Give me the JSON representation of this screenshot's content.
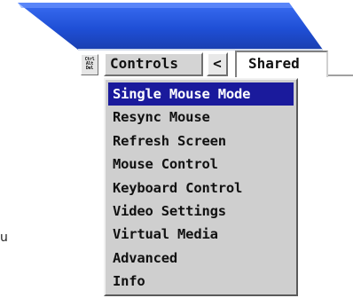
{
  "toolbar": {
    "cad_label": "Ctrl\nAlt\nDel",
    "controls_label": "Controls",
    "back_label": "<",
    "shared_label": "Shared"
  },
  "menu": {
    "items": [
      {
        "label": "Single Mouse Mode",
        "selected": true
      },
      {
        "label": "Resync Mouse",
        "selected": false
      },
      {
        "label": "Refresh Screen",
        "selected": false
      },
      {
        "label": "Mouse Control",
        "selected": false
      },
      {
        "label": "Keyboard Control",
        "selected": false
      },
      {
        "label": "Video Settings",
        "selected": false
      },
      {
        "label": "Virtual Media",
        "selected": false
      },
      {
        "label": "Advanced",
        "selected": false
      },
      {
        "label": "Info",
        "selected": false
      }
    ]
  },
  "background": {
    "partial_text": "u"
  },
  "colors": {
    "banner_blue": "#1f4fd6",
    "selection": "#1a1a9c",
    "menu_bg": "#cfcfcf"
  }
}
